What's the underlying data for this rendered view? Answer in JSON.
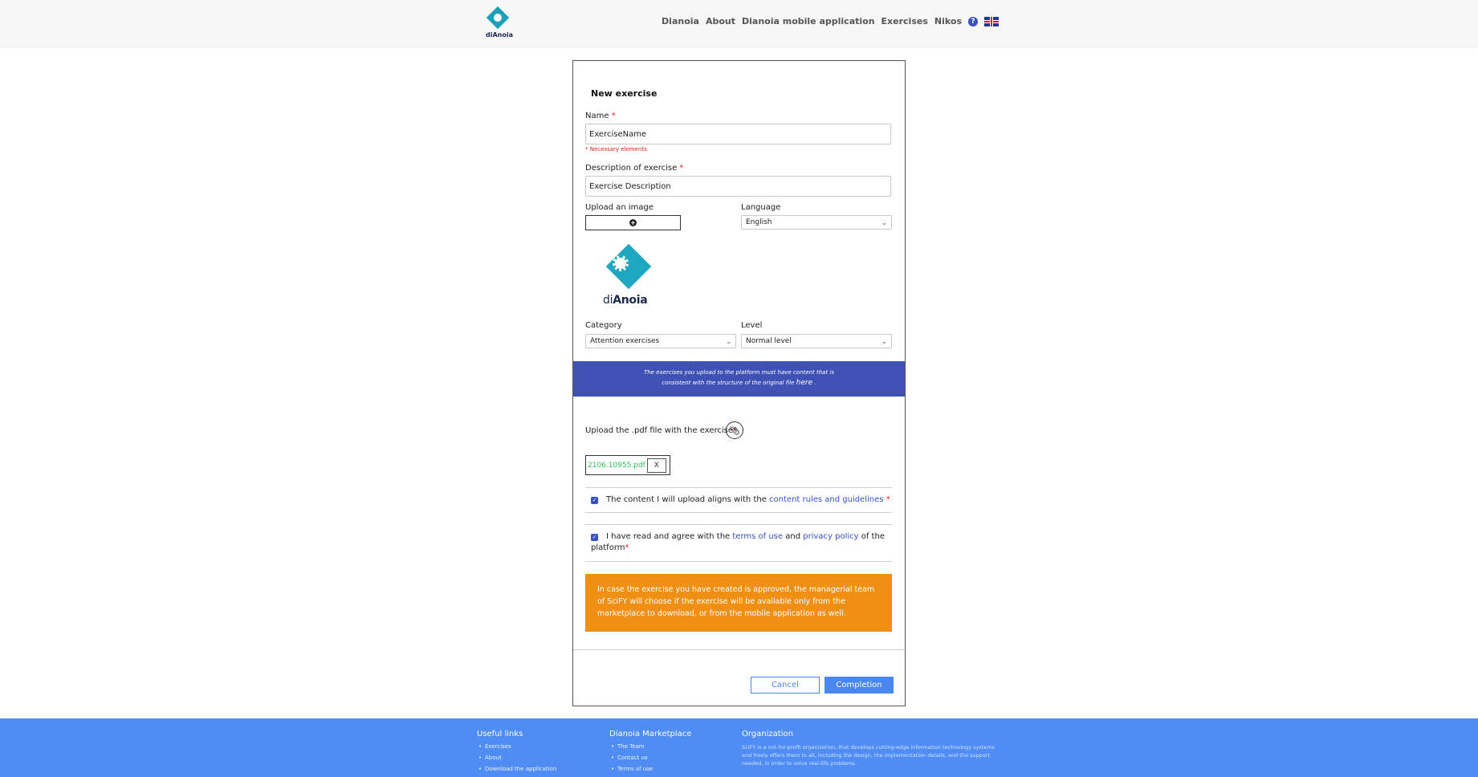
{
  "header": {
    "logo_text": "diAnoia",
    "nav": [
      "Dianoia",
      "About",
      "Dianoia mobile application",
      "Exercises",
      "Nikos"
    ]
  },
  "form": {
    "title": "New exercise",
    "name_label": "Name",
    "name_value": "ExerciseName",
    "necessary_error": "* Necessary elements",
    "description_label": "Description of exercise",
    "description_value": "Exercise Description",
    "upload_image_label": "Upload an image",
    "language_label": "Language",
    "language_value": "English",
    "preview_word_light": "di",
    "preview_word_bold": "Anoia",
    "category_label": "Category",
    "category_value": "Attention exercises",
    "level_label": "Level",
    "level_value": "Normal level",
    "banner_line1": "The exercises you upload to the platform must have content that is",
    "banner_line2": "consistent with the structure of the original file",
    "banner_link": "here",
    "banner_end": ".",
    "pdf_label": "Upload the .pdf file with the exercise",
    "file_name": "2106.10955.pdf",
    "remove_file": "X",
    "check1_text": "The content I will upload aligns with the",
    "check1_link": "content rules and guidelines",
    "check2_text_a": "I have read and agree with the",
    "check2_link_a": "terms of use",
    "check2_and": "and",
    "check2_link_b": "privacy policy",
    "check2_text_b": "of the",
    "check2_text_c": "platform",
    "notice": "In case the exercise you have created is approved, the managerial team of SciFY will choose if the exercise will be available only from the marketplace to download, or from the mobile application as well.",
    "cancel": "Cancel",
    "completion": "Completion"
  },
  "footer": {
    "col1_title": "Useful links",
    "col1_items": [
      "Exercises",
      "About",
      "Download the application"
    ],
    "col2_title": "Dianoia Marketplace",
    "col2_items": [
      "The Team",
      "Contact us",
      "Terms of use"
    ],
    "col3_title": "Organization",
    "col3_text": "SciFY is a not-for-profit organization, that develops cutting-edge information technology systems and freely offers them to all, including the design, the implementation details, and the support needed, in order to solve real-life problems."
  },
  "colors": {
    "accent": "#3f51b5",
    "button": "#4a86f0",
    "notice": "#ef8f14",
    "footer": "#4f8df5"
  }
}
